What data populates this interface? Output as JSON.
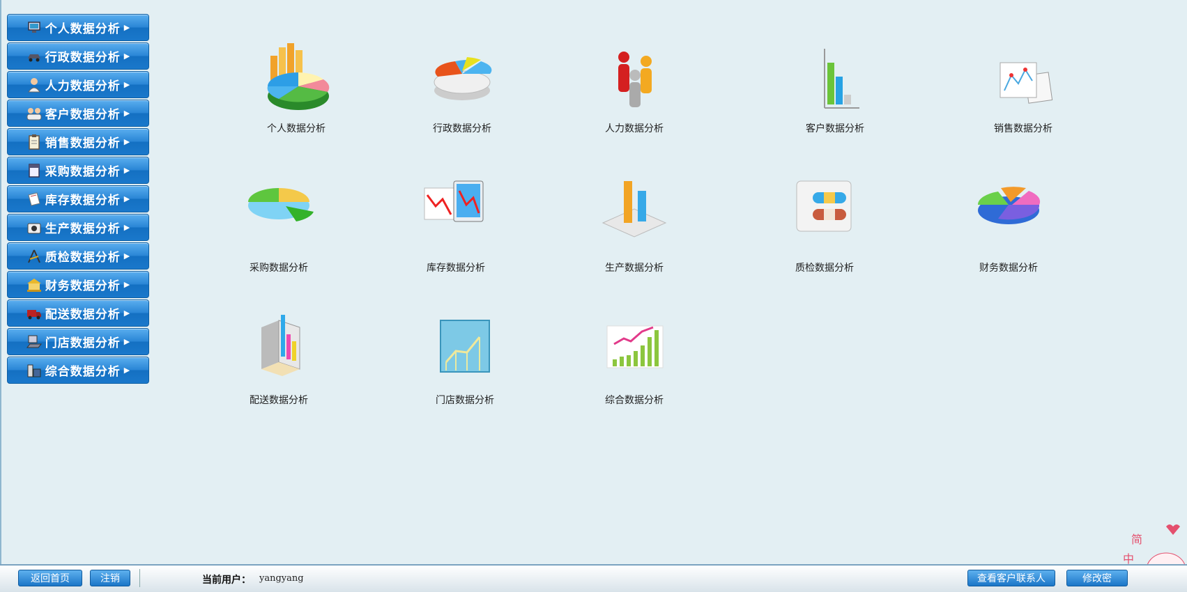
{
  "sidebar": {
    "items": [
      {
        "label": "个人数据分析",
        "icon": "monitor-icon"
      },
      {
        "label": "行政数据分析",
        "icon": "car-icon"
      },
      {
        "label": "人力数据分析",
        "icon": "person-icon"
      },
      {
        "label": "客户数据分析",
        "icon": "people-icon"
      },
      {
        "label": "销售数据分析",
        "icon": "clipboard-icon"
      },
      {
        "label": "采购数据分析",
        "icon": "calendar-icon"
      },
      {
        "label": "库存数据分析",
        "icon": "document-icon"
      },
      {
        "label": "生产数据分析",
        "icon": "camera-icon"
      },
      {
        "label": "质检数据分析",
        "icon": "compass-icon"
      },
      {
        "label": "财务数据分析",
        "icon": "bank-icon"
      },
      {
        "label": "配送数据分析",
        "icon": "truck-icon"
      },
      {
        "label": "门店数据分析",
        "icon": "computer-icon"
      },
      {
        "label": "综合数据分析",
        "icon": "toolbox-icon"
      }
    ]
  },
  "tiles": [
    {
      "label": "个人数据分析",
      "icon": "bar-pie-3d-icon"
    },
    {
      "label": "行政数据分析",
      "icon": "pie-3d-icon"
    },
    {
      "label": "人力数据分析",
      "icon": "people-figures-icon"
    },
    {
      "label": "客户数据分析",
      "icon": "bar-chart-3d-icon"
    },
    {
      "label": "销售数据分析",
      "icon": "report-sheet-icon"
    },
    {
      "label": "采购数据分析",
      "icon": "pie-slice-icon"
    },
    {
      "label": "库存数据分析",
      "icon": "stock-monitor-icon"
    },
    {
      "label": "生产数据分析",
      "icon": "bar-3d-base-icon"
    },
    {
      "label": "质检数据分析",
      "icon": "pill-box-icon"
    },
    {
      "label": "财务数据分析",
      "icon": "pie-exploded-icon"
    },
    {
      "label": "配送数据分析",
      "icon": "bar-box-3d-icon"
    },
    {
      "label": "门店数据分析",
      "icon": "line-chart-icon"
    },
    {
      "label": "综合数据分析",
      "icon": "growth-chart-icon"
    }
  ],
  "footer": {
    "home_label": "返回首页",
    "logout_label": "注销",
    "current_user_label": "当前用户：",
    "current_user": "yangyang",
    "contacts_label": "查看客户联系人",
    "change_password_label": "修改密"
  },
  "colors": {
    "background": "#e3eff3",
    "button_blue": "#1a78cb"
  }
}
